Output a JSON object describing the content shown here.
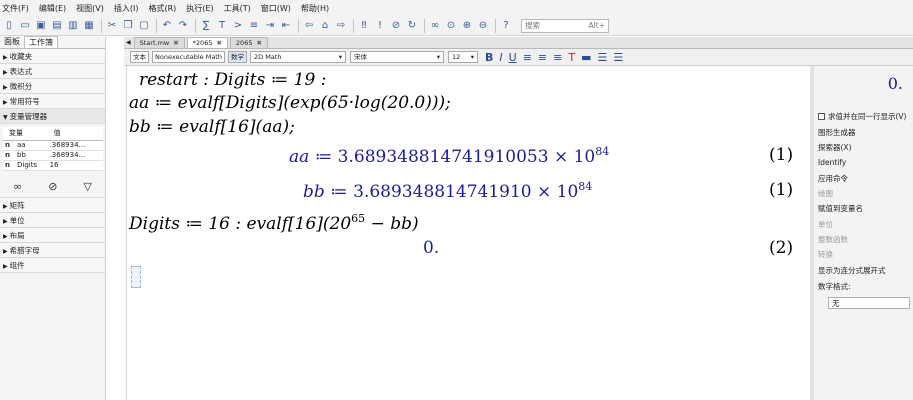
{
  "menu": [
    "文件(F)",
    "编辑(E)",
    "视图(V)",
    "插入(I)",
    "格式(R)",
    "执行(E)",
    "工具(T)",
    "窗口(W)",
    "帮助(H)"
  ],
  "search": {
    "placeholder": "搜索",
    "shortcut": "Alt+"
  },
  "panel": {
    "tabs": [
      "面板",
      "工作簿"
    ],
    "palettes_top": [
      "收藏夹",
      "表达式",
      "微积分",
      "常用符号"
    ],
    "variable_manager": "变量管理器",
    "var_table": {
      "headers": [
        "变量",
        "值"
      ],
      "rows": [
        {
          "kind": "n",
          "name": "aa",
          "value": ".368934..."
        },
        {
          "kind": "n",
          "name": "bb",
          "value": ".368934..."
        },
        {
          "kind": "n",
          "name": "Digits",
          "value": "16"
        }
      ]
    },
    "palettes_bottom": [
      "矩阵",
      "单位",
      "布局",
      "希腊字母",
      "组件"
    ]
  },
  "doc_tabs": [
    {
      "label": "Start.mw",
      "active": false
    },
    {
      "label": "*2065",
      "active": true
    },
    {
      "label": "2065",
      "active": false
    }
  ],
  "ctx_toolbar": {
    "text_btn": "文本",
    "mode": "Nonexecutable Math",
    "math_btn": "数学",
    "math_type": "2D Math",
    "font": "宋体",
    "size": "12"
  },
  "worksheet": {
    "line1": "restart : Digits ≔ 19 :",
    "line2": "aa ≔ evalf[Digits](exp(65·log(20.0)));",
    "line3": "bb ≔ evalf[16](aa);",
    "out1_lhs": "aa",
    "out1_mant": "≔ 3.689348814741910053 × 10",
    "out1_exp": "84",
    "out1_label": "(1)",
    "out2_lhs": "bb",
    "out2_mant": "≔ 3.689348814741910 × 10",
    "out2_exp": "84",
    "out2_label": "(1)",
    "line4_pre": "Digits ≔ 16 : evalf[16](20",
    "line4_exp": "65",
    "line4_post": " − bb)",
    "out3": "0.",
    "out3_label": "(2)"
  },
  "context_panel": {
    "value": "0.",
    "checkbox_label": "求值并在同一行显示(V)",
    "items": [
      "图形生成器",
      "探索器(X)",
      "Identify",
      "应用命令",
      "绘图",
      "赋值到变量名",
      "单位",
      "整数函数",
      "转换",
      "显示为连分式展开式",
      "数字格式:"
    ],
    "number_format": "无"
  }
}
